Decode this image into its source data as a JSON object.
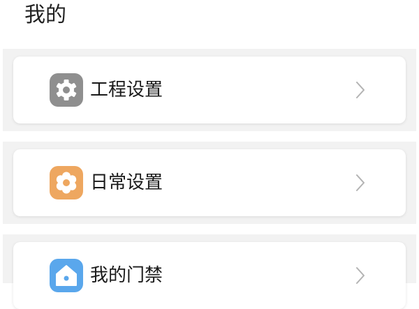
{
  "header": {
    "title": "我的"
  },
  "menu": {
    "items": [
      {
        "label": "工程设置",
        "icon": "gear-icon",
        "icon_color": "#8f8f8f"
      },
      {
        "label": "日常设置",
        "icon": "flower-settings-icon",
        "icon_color": "#eea760"
      },
      {
        "label": "我的门禁",
        "icon": "home-icon",
        "icon_color": "#5aa7ec"
      }
    ]
  },
  "colors": {
    "background": "#ffffff",
    "section_band": "#f2f2f2",
    "card": "#ffffff",
    "chevron": "#b3b3b3",
    "text": "#1a1a1a"
  }
}
